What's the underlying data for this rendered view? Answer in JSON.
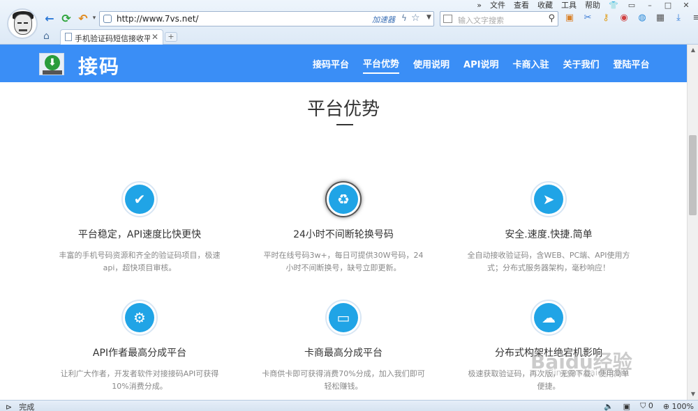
{
  "browser": {
    "menu": [
      "文件",
      "查看",
      "收藏",
      "工具",
      "帮助"
    ],
    "url": "http://www.7vs.net/",
    "accelerator_label": "加速器",
    "search_placeholder": "输入文字搜索",
    "tab_title": "手机验证码短信接收平台",
    "status_text": "完成",
    "shield_count": "0",
    "zoom": "100%"
  },
  "site": {
    "logo_text": "接码",
    "nav": [
      "接码平台",
      "平台优势",
      "使用说明",
      "API说明",
      "卡商入驻",
      "关于我们",
      "登陆平台"
    ],
    "active_nav": "平台优势",
    "section_title": "平台优势"
  },
  "features": [
    {
      "icon": "check-icon",
      "heading": "平台稳定，API速度比快更快",
      "desc": "丰富的手机号码资源和齐全的验证码项目，极速api，超快项目审核。"
    },
    {
      "icon": "recycle-icon",
      "heading": "24小时不间断轮换号码",
      "desc": "平时在线号码3w+，每日可提供30W号码，24小时不间断换号，缺号立即更新。"
    },
    {
      "icon": "paper-plane-icon",
      "heading": "安全.速度.快捷.简单",
      "desc": "全自动接收验证码，含WEB、PC端、API使用方式；分布式服务器架构，毫秒响应！"
    },
    {
      "icon": "gears-icon",
      "heading": "API作者最高分成平台",
      "desc": "让利广大作者，开发者软件对接接码API可获得10%消费分成。"
    },
    {
      "icon": "card-icon",
      "heading": "卡商最高分成平台",
      "desc": "卡商供卡即可获得消费70%分成，加入我们即可轻松赚钱。"
    },
    {
      "icon": "cloud-icon",
      "heading": "分布式构架杜绝宕机影响",
      "desc": "极速获取验证码，再次版，无需下载、使用简单便捷。"
    }
  ],
  "watermark": {
    "text": "Baidu经验",
    "sub": "jingyan.baidu.com"
  },
  "colors": {
    "header_blue": "#3a8ef6",
    "icon_blue": "#20a4e6"
  }
}
